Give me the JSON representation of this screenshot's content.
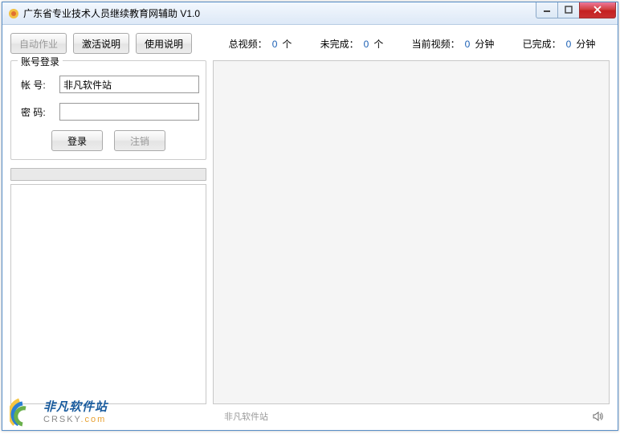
{
  "window": {
    "title": "广东省专业技术人员继续教育网辅助  V1.0"
  },
  "toolbar": {
    "auto_job": "自动作业",
    "activate_help": "激活说明",
    "usage_help": "使用说明"
  },
  "stats": {
    "total_video_label": "总视频：",
    "total_video_value": "0",
    "total_video_unit": "个",
    "incomplete_label": "未完成：",
    "incomplete_value": "0",
    "incomplete_unit": "个",
    "current_video_label": "当前视频：",
    "current_video_value": "0",
    "current_video_unit": "分钟",
    "completed_label": "已完成：",
    "completed_value": "0",
    "completed_unit": "分钟"
  },
  "login": {
    "legend": "账号登录",
    "account_label": "帐   号:",
    "account_value": "非凡软件站",
    "password_label": "密   码:",
    "password_value": "",
    "login_btn": "登录",
    "logout_btn": "注销"
  },
  "status": {
    "text": "非凡软件站"
  },
  "watermark": {
    "cn": "非凡软件站",
    "en_main": "CRSKY",
    "en_suffix": ".com"
  }
}
